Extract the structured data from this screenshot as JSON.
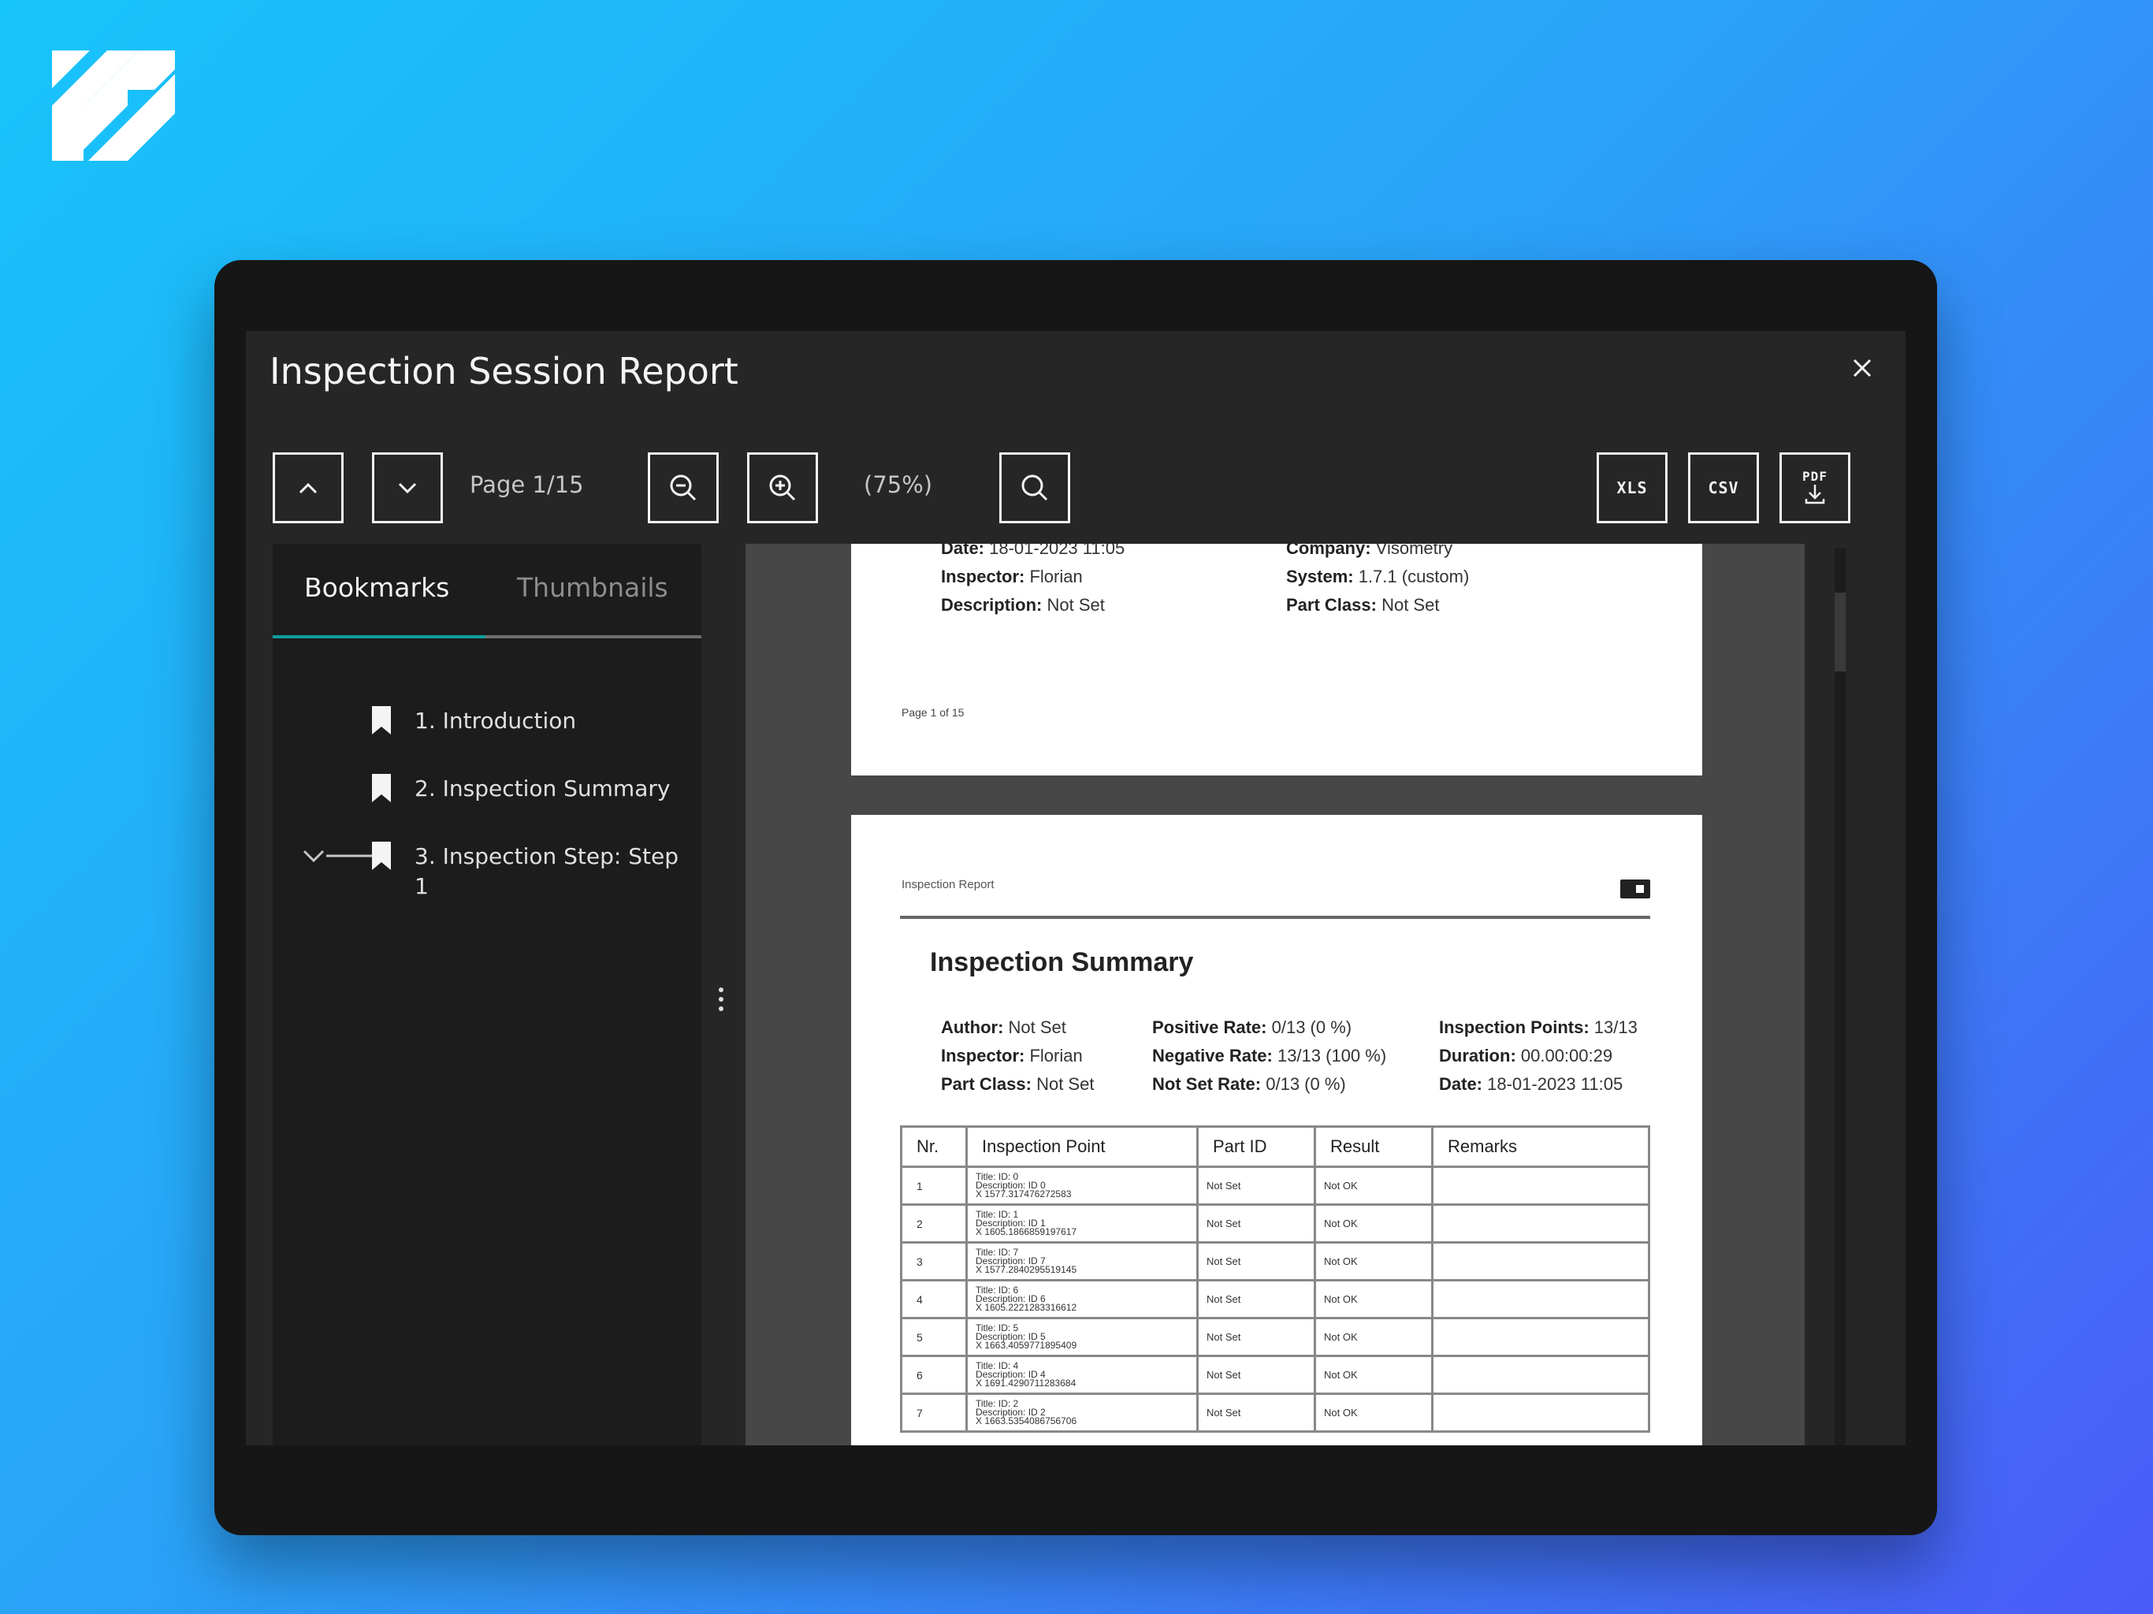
{
  "modal": {
    "title": "Inspection Session Report"
  },
  "toolbar": {
    "page_label": "Page 1/15",
    "zoom_label": "(75%)",
    "export_xls": "XLS",
    "export_csv": "CSV",
    "export_pdf": "PDF"
  },
  "sidebar": {
    "tabs": [
      {
        "label": "Bookmarks",
        "active": true
      },
      {
        "label": "Thumbnails",
        "active": false
      }
    ],
    "bookmarks": [
      {
        "label": "1. Introduction"
      },
      {
        "label": "2. Inspection Summary"
      },
      {
        "label": "3. Inspection Step: Step 1",
        "expanded": true
      }
    ]
  },
  "page1": {
    "left_fields": [
      {
        "key": "Date:",
        "value": " 18-01-2023 11:05"
      },
      {
        "key": "Inspector:",
        "value": " Florian"
      },
      {
        "key": "Description:",
        "value": " Not Set"
      }
    ],
    "right_fields": [
      {
        "key": "Company:",
        "value": " Visometry"
      },
      {
        "key": "System:",
        "value": " 1.7.1 (custom)"
      },
      {
        "key": "Part Class:",
        "value": " Not Set"
      }
    ],
    "footer": "Page 1 of 15"
  },
  "page2": {
    "header": "Inspection Report",
    "title": "Inspection Summary",
    "col1": [
      {
        "key": "Author:",
        "value": " Not Set"
      },
      {
        "key": "Inspector:",
        "value": " Florian"
      },
      {
        "key": "Part Class:",
        "value": " Not Set"
      }
    ],
    "col2": [
      {
        "key": "Positive Rate:",
        "value": " 0/13 (0 %)"
      },
      {
        "key": "Negative Rate:",
        "value": " 13/13 (100 %)"
      },
      {
        "key": "Not Set Rate:",
        "value": " 0/13 (0 %)"
      }
    ],
    "col3": [
      {
        "key": "Inspection Points:",
        "value": " 13/13"
      },
      {
        "key": "Duration:",
        "value": " 00.00:00:29"
      },
      {
        "key": "Date:",
        "value": " 18-01-2023 11:05"
      }
    ],
    "table": {
      "headers": [
        "Nr.",
        "Inspection Point",
        "Part ID",
        "Result",
        "Remarks"
      ],
      "rows": [
        {
          "nr": "1",
          "l1": "Title: ID: 0",
          "l2": "Description: ID 0",
          "l3": "X 1577.317476272583",
          "part": "Not Set",
          "result": "Not OK",
          "remarks": ""
        },
        {
          "nr": "2",
          "l1": "Title: ID: 1",
          "l2": "Description: ID 1",
          "l3": "X 1605.1866859197617",
          "part": "Not Set",
          "result": "Not OK",
          "remarks": ""
        },
        {
          "nr": "3",
          "l1": "Title: ID: 7",
          "l2": "Description: ID 7",
          "l3": "X 1577.2840295519145",
          "part": "Not Set",
          "result": "Not OK",
          "remarks": ""
        },
        {
          "nr": "4",
          "l1": "Title: ID: 6",
          "l2": "Description: ID 6",
          "l3": "X 1605.2221283316612",
          "part": "Not Set",
          "result": "Not OK",
          "remarks": ""
        },
        {
          "nr": "5",
          "l1": "Title: ID: 5",
          "l2": "Description: ID 5",
          "l3": "X 1663.4059771895409",
          "part": "Not Set",
          "result": "Not OK",
          "remarks": ""
        },
        {
          "nr": "6",
          "l1": "Title: ID: 4",
          "l2": "Description: ID 4",
          "l3": "X 1691.4290711283684",
          "part": "Not Set",
          "result": "Not OK",
          "remarks": ""
        },
        {
          "nr": "7",
          "l1": "Title: ID: 2",
          "l2": "Description: ID 2",
          "l3": "X 1663.5354086756706",
          "part": "Not Set",
          "result": "Not OK",
          "remarks": ""
        }
      ]
    }
  }
}
